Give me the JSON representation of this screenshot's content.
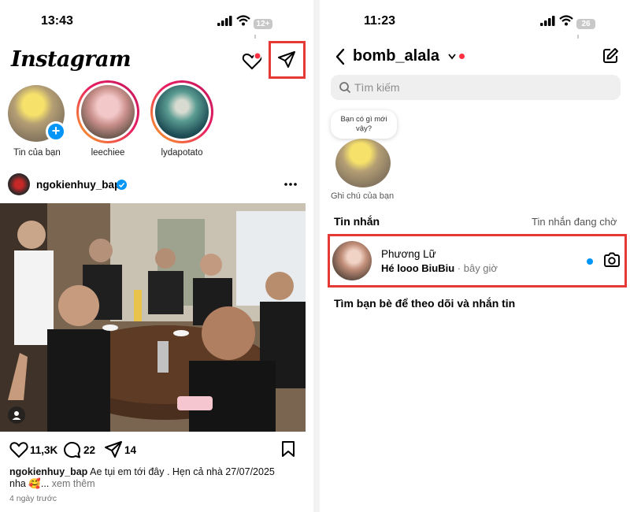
{
  "left": {
    "status": {
      "time": "13:43",
      "battery": "12+"
    },
    "header": {
      "logo": "Instagram"
    },
    "stories": [
      {
        "label": "Tin của bạn"
      },
      {
        "label": "leechiee"
      },
      {
        "label": "lydapotato"
      }
    ],
    "post": {
      "username": "ngokienhuy_bap",
      "likes": "11,3K",
      "comments": "22",
      "shares": "14",
      "caption_user": "ngokienhuy_bap",
      "caption_text": "Ae tụi em tới đây . Hẹn cả nhà 27/07/2025",
      "caption_line2": "nha 🥰...",
      "see_more": "xem thêm",
      "time_ago": "4 ngày trước"
    }
  },
  "right": {
    "status": {
      "time": "11:23",
      "battery": "26"
    },
    "header": {
      "username": "bomb_alala"
    },
    "search": {
      "placeholder": "Tìm kiếm"
    },
    "note": {
      "bubble_line1": "Bạn có gì mới",
      "bubble_line2": "vậy?",
      "label": "Ghi chú của bạn"
    },
    "messages_label": "Tin nhắn",
    "requests_label": "Tin nhắn đang chờ",
    "conversation": {
      "name": "Phương Lữ",
      "preview": "Hé looo BiuBiu",
      "time": "· bây giờ"
    },
    "find_friends": "Tìm bạn bè để theo dõi và nhắn tin"
  },
  "colors": {
    "highlight": "#e53935",
    "link_blue": "#0095f6",
    "verified": "#0095f6",
    "notification_red": "#ff3040"
  },
  "icons": [
    "heart-icon",
    "paper-plane-icon",
    "more-icon",
    "comment-icon",
    "bookmark-icon",
    "back-chevron-icon",
    "compose-icon",
    "search-icon",
    "camera-icon",
    "verified-badge-icon",
    "user-tag-icon"
  ]
}
